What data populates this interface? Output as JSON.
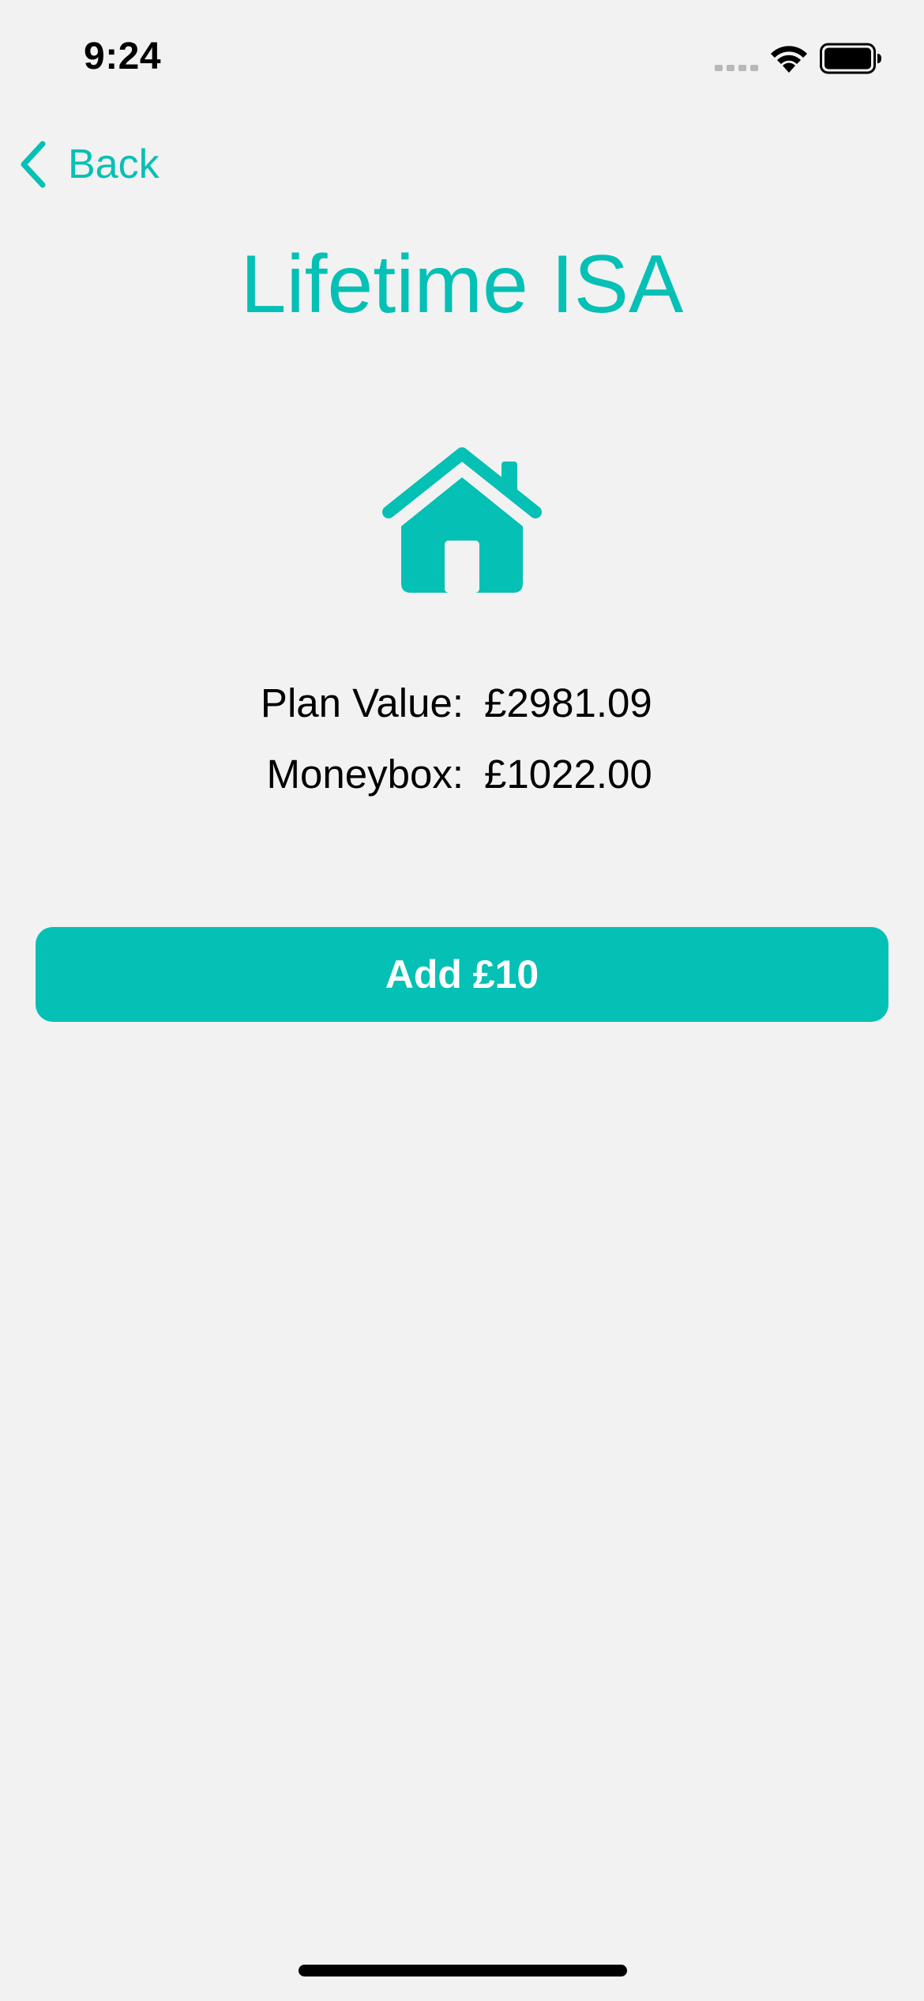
{
  "status_bar": {
    "time": "9:24",
    "icons": [
      "signal-icon",
      "wifi-icon",
      "battery-icon"
    ]
  },
  "nav": {
    "back_label": "Back",
    "back_icon": "chevron-left-icon"
  },
  "title": "Lifetime ISA",
  "hero": {
    "icon": "house-icon"
  },
  "details": [
    {
      "label": "Plan Value:",
      "value": "£2981.09"
    },
    {
      "label": "Moneybox:",
      "value": "£1022.00"
    }
  ],
  "action": {
    "add_label": "Add £10"
  },
  "colors": {
    "accent": "#05c0b4",
    "background": "#f2f2f2",
    "text": "#000000"
  }
}
